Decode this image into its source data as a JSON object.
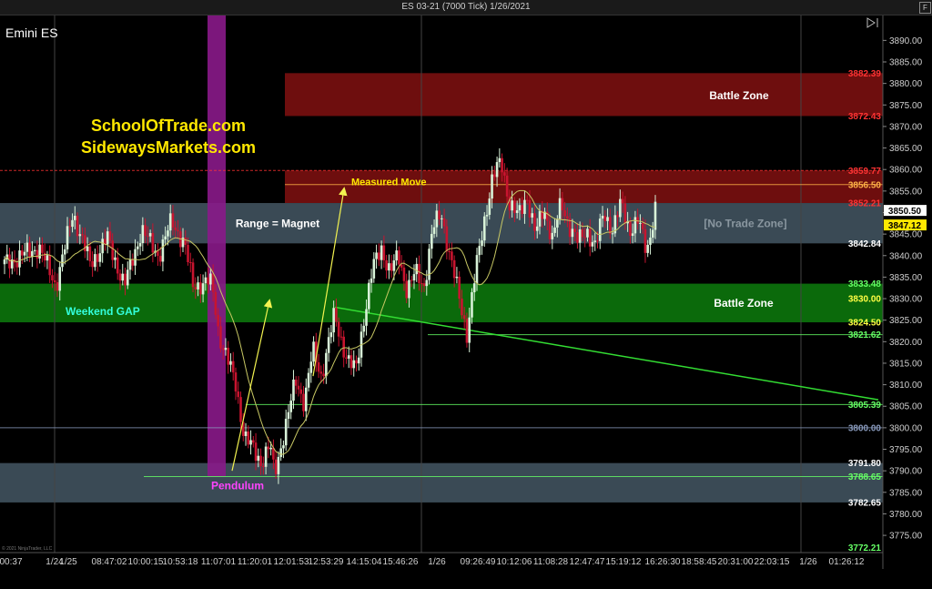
{
  "window": {
    "title": "ES 03-21 (7000 Tick)  1/26/2021",
    "f_button": "F",
    "copyright": "© 2021 NinjaTrader, LLC"
  },
  "instrument": "Emini ES",
  "watermark": {
    "line1": "SchoolOfTrade.com",
    "line2": "SidewaysMarkets.com"
  },
  "colors": {
    "background": "#000000",
    "upper_battle_zone": "#6e0e0e",
    "range_band": "#3a4a55",
    "lower_battle_zone": "#0b6a0b",
    "bottom_band": "#3a4a55",
    "pendulum_bar": "#8a1a8a",
    "candle_up": "#d8f2d8",
    "candle_down": "#c8142f",
    "moving_average": "#c8c864",
    "arrow": "#f3f350",
    "trend_line": "#33dd33"
  },
  "chart_data": {
    "type": "candlestick",
    "title": "ES 03-21 (7000 Tick)  1/26/2021",
    "ylim": [
      3771,
      3896
    ],
    "y_ticks": [
      3775,
      3780,
      3785,
      3790,
      3795,
      3800,
      3805,
      3810,
      3815,
      3820,
      3825,
      3830,
      3835,
      3840,
      3845,
      3850,
      3855,
      3860,
      3865,
      3870,
      3875,
      3880,
      3885,
      3890
    ],
    "x_ticks": [
      "00:37",
      "1/24",
      "1/25",
      "08:47:02",
      "10:00:15",
      "10:53:18",
      "11:07:01",
      "11:20:01",
      "12:01:53",
      "12:53:29",
      "14:15:04",
      "15:46:26",
      "1/26",
      "09:26:49",
      "10:12:06",
      "11:08:28",
      "12:47:47",
      "15:19:12",
      "16:26:30",
      "18:58:45",
      "20:31:00",
      "22:03:15",
      "1/26",
      "01:26:12"
    ],
    "zones": [
      {
        "label": "Battle Zone",
        "top": 3882.39,
        "bottom": 3872.43,
        "color_key": "upper_battle_zone"
      },
      {
        "label": "",
        "top": 3859.77,
        "bottom": 3852.21,
        "color_key": "upper_battle_zone"
      },
      {
        "label": "[No Trade Zone]",
        "top": 3852.21,
        "bottom": 3842.84,
        "color_key": "range_band"
      },
      {
        "label": "Battle Zone",
        "top": 3833.48,
        "bottom": 3824.5,
        "color_key": "lower_battle_zone"
      },
      {
        "label": "",
        "top": 3791.8,
        "bottom": 3782.65,
        "color_key": "bottom_band"
      }
    ],
    "levels": [
      {
        "label": "3882.39",
        "value": 3882.39,
        "color": "#ff3333"
      },
      {
        "label": "3872.43",
        "value": 3872.43,
        "color": "#ff3333"
      },
      {
        "label": "3859.77",
        "value": 3859.77,
        "color": "#ff3333"
      },
      {
        "label": "3856.50",
        "value": 3856.5,
        "color": "#ffb347"
      },
      {
        "label": "3852.21",
        "value": 3852.21,
        "color": "#ff3333"
      },
      {
        "label": "3842.84",
        "value": 3842.84,
        "color": "#ffffff"
      },
      {
        "label": "3833.48",
        "value": 3833.48,
        "color": "#66ff66"
      },
      {
        "label": "3830.00",
        "value": 3830,
        "color": "#ffff44"
      },
      {
        "label": "3824.50",
        "value": 3824.5,
        "color": "#ffff44"
      },
      {
        "label": "3821.62",
        "value": 3821.62,
        "color": "#66ff66"
      },
      {
        "label": "3805.39",
        "value": 3805.39,
        "color": "#66ff66"
      },
      {
        "label": "3800.00",
        "value": 3800,
        "color": "#8899bb"
      },
      {
        "label": "3791.80",
        "value": 3791.8,
        "color": "#ffffff"
      },
      {
        "label": "3788.65",
        "value": 3788.65,
        "color": "#66ff66"
      },
      {
        "label": "3782.65",
        "value": 3782.65,
        "color": "#ffffff"
      },
      {
        "label": "3772.21",
        "value": 3772.21,
        "color": "#66ff66"
      }
    ],
    "current_price": {
      "label": "3850.50",
      "value": 3850.5
    },
    "secondary_price": {
      "label": "3847.12",
      "value": 3847.12
    },
    "annotations": [
      {
        "text": "Range = Magnet",
        "color": "#ffffff"
      },
      {
        "text": "Measured Move",
        "color": "#ffe800"
      },
      {
        "text": "Weekend GAP",
        "color": "#33ffdd"
      },
      {
        "text": "Pendulum",
        "color": "#ff44ff"
      }
    ],
    "price_path": [
      [
        0,
        3838
      ],
      [
        4,
        3842
      ],
      [
        6,
        3833
      ],
      [
        8,
        3850
      ],
      [
        10,
        3838
      ],
      [
        12,
        3844
      ],
      [
        14,
        3833
      ],
      [
        16,
        3846
      ],
      [
        18,
        3840
      ],
      [
        19.5,
        3848
      ],
      [
        21,
        3843
      ],
      [
        22,
        3833
      ],
      [
        24,
        3834
      ],
      [
        24.5,
        3830
      ],
      [
        25,
        3822
      ],
      [
        27,
        3810
      ],
      [
        28,
        3798
      ],
      [
        30,
        3792
      ],
      [
        31,
        3796
      ],
      [
        31.5,
        3789
      ],
      [
        33,
        3802
      ],
      [
        34,
        3811
      ],
      [
        35,
        3806
      ],
      [
        36,
        3818
      ],
      [
        37,
        3812
      ],
      [
        38.5,
        3826
      ],
      [
        40,
        3816
      ],
      [
        41,
        3813
      ],
      [
        42,
        3826
      ],
      [
        43,
        3837
      ],
      [
        44,
        3842
      ],
      [
        45,
        3836
      ],
      [
        46,
        3840
      ],
      [
        47,
        3832
      ],
      [
        48,
        3836
      ],
      [
        49,
        3833
      ],
      [
        50,
        3846
      ],
      [
        51,
        3850
      ],
      [
        52,
        3840
      ],
      [
        53,
        3831
      ],
      [
        54,
        3822
      ],
      [
        55,
        3836
      ],
      [
        56,
        3848
      ],
      [
        57,
        3858
      ],
      [
        58,
        3862
      ],
      [
        59,
        3852
      ],
      [
        60,
        3849
      ],
      [
        61,
        3854
      ],
      [
        62,
        3845
      ],
      [
        63,
        3851
      ],
      [
        64,
        3844
      ],
      [
        65,
        3852
      ],
      [
        66,
        3847
      ],
      [
        67,
        3843
      ],
      [
        68,
        3846
      ],
      [
        69,
        3842
      ],
      [
        70,
        3850
      ],
      [
        71,
        3846
      ],
      [
        72,
        3852
      ],
      [
        73,
        3846
      ],
      [
        74,
        3848
      ],
      [
        75,
        3841
      ],
      [
        76,
        3851
      ]
    ]
  }
}
